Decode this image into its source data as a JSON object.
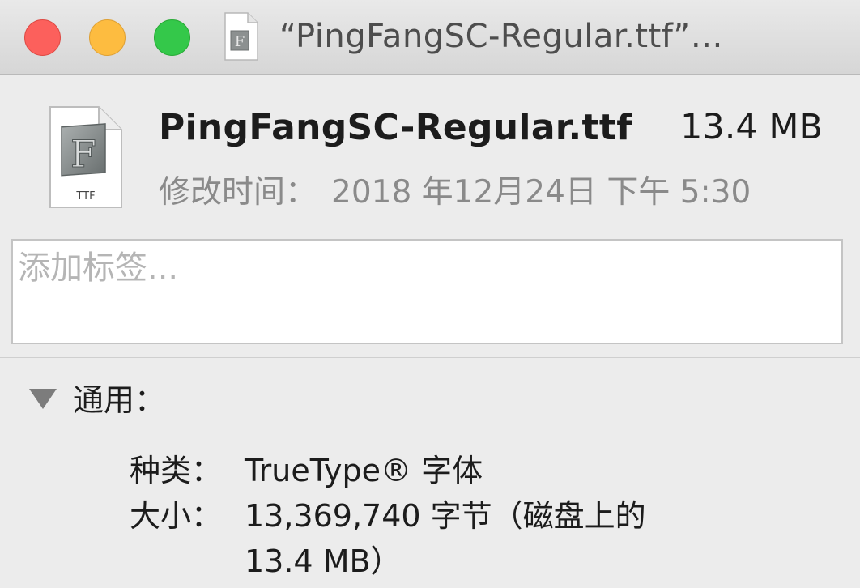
{
  "window": {
    "title": "“PingFangSC-Regular.ttf”…",
    "controls": {
      "close": "#fc605c",
      "minimize": "#fdbc40",
      "zoom": "#34c84a"
    },
    "title_icon": "ttf-document-icon"
  },
  "header": {
    "file_icon": "ttf-font-file-icon",
    "file_icon_label": "TTF",
    "file_name": "PingFangSC-Regular.ttf",
    "file_size": "13.4 MB",
    "modified_label": "修改时间：",
    "modified_value": "2018 年12月24日 下午 5:30"
  },
  "tags": {
    "placeholder": "添加标签...",
    "value": ""
  },
  "general": {
    "label": "通用：",
    "expanded": true,
    "rows": [
      {
        "label": "种类：",
        "value": "TrueType® 字体"
      },
      {
        "label": "大小：",
        "value": "13,369,740 字节（磁盘上的",
        "value_cont": "13.4 MB）"
      }
    ]
  }
}
